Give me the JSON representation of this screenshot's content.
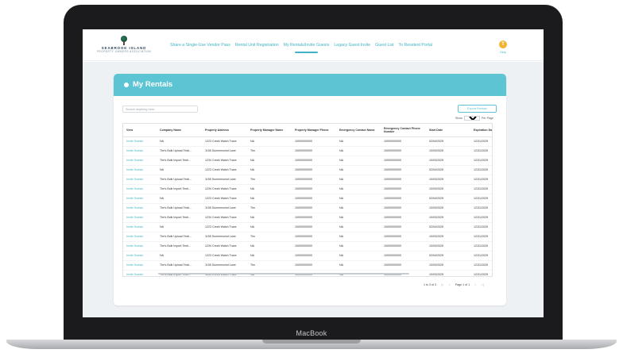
{
  "device_label": "MacBook",
  "header": {
    "logo_name": "SEABROOK ISLAND",
    "logo_sub": "PROPERTY OWNERS ASSOCIATION",
    "nav": [
      {
        "label": "Share a Single-Use Vendor Pass",
        "active": false
      },
      {
        "label": "Rental Unit Registration",
        "active": false
      },
      {
        "label": "My Rentals/Invite Guests",
        "active": true
      },
      {
        "label": "Legacy Guest Invite",
        "active": false
      },
      {
        "label": "Guest List",
        "active": false
      },
      {
        "label": "To Resident Portal",
        "active": false
      }
    ],
    "avatar_initial": "T",
    "help_label": "Help"
  },
  "panel": {
    "title": "My Rentals",
    "search_placeholder": "Search anything here...",
    "export_label": "Export Rentals",
    "show_label": "Show",
    "per_page_value": "25",
    "per_page_label": "Per Page"
  },
  "table": {
    "columns": [
      "View",
      "Company Name",
      "Property Address",
      "Property Manager Name",
      "Property Manager Phone",
      "Emergency Contact Name",
      "Emergency Contact Phone Number",
      "Start Date",
      "Expiration Date"
    ],
    "rows": [
      [
        "Invite Guests",
        "NA",
        "1223 Creek Watch Trace",
        "NA",
        "10000000000",
        "NA",
        "10000000000",
        "02/04/2025",
        "12/31/2025"
      ],
      [
        "Invite Guests",
        "Tim's Bulk Upload Testi...",
        "1155 Summerwind Lane",
        "Tim",
        "10000000000",
        "NA",
        "10000000000",
        "10/03/2025",
        "12/31/2025"
      ],
      [
        "Invite Guests",
        "Tim's Bulk Import Testi...",
        "1234 Creek Watch Trace",
        "NA",
        "10000000000",
        "NA",
        "10000000000",
        "10/03/2025",
        "12/31/2025"
      ],
      [
        "Invite Guests",
        "NA",
        "1223 Creek Watch Trace",
        "NA",
        "10000000000",
        "NA",
        "10000000000",
        "02/04/2025",
        "12/31/2025"
      ],
      [
        "Invite Guests",
        "Tim's Bulk Upload Testi...",
        "1155 Summerwind Lane",
        "Tim",
        "10000000000",
        "NA",
        "10000000000",
        "10/03/2025",
        "12/31/2025"
      ],
      [
        "Invite Guests",
        "Tim's Bulk Import Testi...",
        "1234 Creek Watch Trace",
        "NA",
        "10000000000",
        "NA",
        "10000000000",
        "10/03/2025",
        "12/31/2025"
      ],
      [
        "Invite Guests",
        "NA",
        "1223 Creek Watch Trace",
        "NA",
        "10000000000",
        "NA",
        "10000000000",
        "02/04/2025",
        "12/31/2025"
      ],
      [
        "Invite Guests",
        "Tim's Bulk Upload Testi...",
        "1155 Summerwind Lane",
        "Tim",
        "10000000000",
        "NA",
        "10000000000",
        "10/03/2025",
        "12/31/2025"
      ],
      [
        "Invite Guests",
        "Tim's Bulk Import Testi...",
        "1234 Creek Watch Trace",
        "NA",
        "10000000000",
        "NA",
        "10000000000",
        "10/03/2025",
        "12/31/2025"
      ],
      [
        "Invite Guests",
        "NA",
        "1223 Creek Watch Trace",
        "NA",
        "10000000000",
        "NA",
        "10000000000",
        "02/04/2025",
        "12/31/2025"
      ],
      [
        "Invite Guests",
        "Tim's Bulk Upload Testi...",
        "1155 Summerwind Lane",
        "Tim",
        "10000000000",
        "NA",
        "10000000000",
        "10/03/2025",
        "12/31/2025"
      ],
      [
        "Invite Guests",
        "Tim's Bulk Import Testi...",
        "1234 Creek Watch Trace",
        "NA",
        "10000000000",
        "NA",
        "10000000000",
        "10/03/2025",
        "12/31/2025"
      ],
      [
        "Invite Guests",
        "NA",
        "1223 Creek Watch Trace",
        "NA",
        "10000000000",
        "NA",
        "10000000000",
        "02/04/2025",
        "12/31/2025"
      ],
      [
        "Invite Guests",
        "Tim's Bulk Upload Testi...",
        "1155 Summerwind Lane",
        "Tim",
        "10000000000",
        "NA",
        "10000000000",
        "10/03/2025",
        "12/31/2025"
      ],
      [
        "Invite Guests",
        "Tim's Bulk Import Testi...",
        "1234 Creek Watch Trace",
        "NA",
        "10000000000",
        "NA",
        "10000000000",
        "10/03/2025",
        "12/31/2025"
      ]
    ]
  },
  "pagination": {
    "range_label": "1 to 3 of 3",
    "page_label": "Page 1 of 1",
    "first_icon": "|<",
    "prev_icon": "<",
    "next_icon": ">",
    "last_icon": ">|"
  }
}
